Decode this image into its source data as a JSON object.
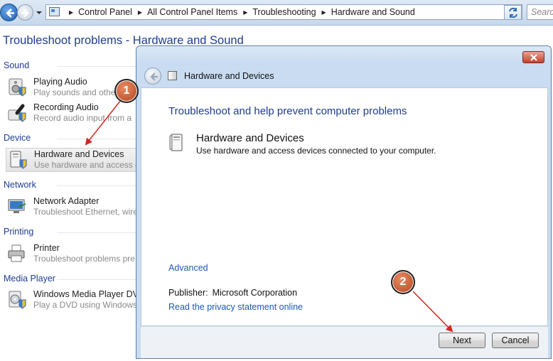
{
  "address_bar": {
    "breadcrumbs": [
      "Control Panel",
      "All Control Panel Items",
      "Troubleshooting",
      "Hardware and Sound"
    ]
  },
  "search": {
    "placeholder": "Search"
  },
  "page": {
    "title": "Troubleshoot problems - Hardware and Sound",
    "categories": [
      {
        "label": "Sound",
        "items": [
          {
            "title": "Playing Audio",
            "desc": "Play sounds and other",
            "icon": "speaker-icon"
          },
          {
            "title": "Recording Audio",
            "desc": "Record audio input from a",
            "icon": "microphone-icon"
          }
        ]
      },
      {
        "label": "Device",
        "items": [
          {
            "title": "Hardware and Devices",
            "desc": "Use hardware and access de",
            "icon": "hardware-icon",
            "selected": true
          }
        ]
      },
      {
        "label": "Network",
        "items": [
          {
            "title": "Network Adapter",
            "desc": "Troubleshoot Ethernet, wire",
            "icon": "network-adapter-icon"
          }
        ]
      },
      {
        "label": "Printing",
        "items": [
          {
            "title": "Printer",
            "desc": "Troubleshoot problems pre",
            "icon": "printer-icon"
          }
        ]
      },
      {
        "label": "Media Player",
        "items": [
          {
            "title": "Windows Media Player DVD",
            "desc": "Play a DVD using Windows",
            "icon": "dvd-icon"
          }
        ]
      }
    ]
  },
  "dialog": {
    "title": "Hardware and Devices",
    "heading": "Troubleshoot and help prevent computer problems",
    "item_title": "Hardware and Devices",
    "item_desc": "Use hardware and access devices connected to your computer.",
    "advanced_link": "Advanced",
    "publisher_label": "Publisher:",
    "publisher_value": "Microsoft Corporation",
    "privacy_link": "Read the privacy statement online",
    "next_label": "Next",
    "cancel_label": "Cancel"
  },
  "annotations": {
    "step1": "1",
    "step2": "2",
    "color": "#d9231f"
  },
  "colors": {
    "link": "#1c5bb7",
    "heading": "#1e3d8f",
    "badge": "#c45a2f"
  }
}
